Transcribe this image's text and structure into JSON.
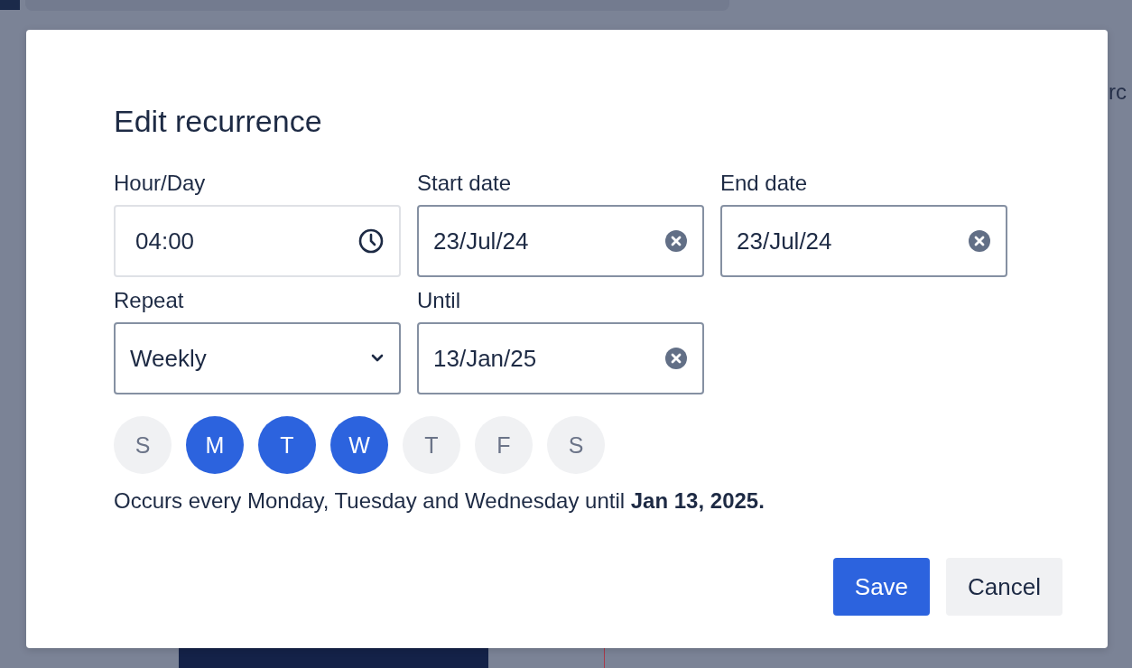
{
  "background": {
    "search_fragment": "rc"
  },
  "dialog": {
    "title": "Edit recurrence",
    "fields": [
      {
        "label": "Hour/Day",
        "kind": "time",
        "value": "04:00"
      },
      {
        "label": "Start date",
        "kind": "date",
        "value": "23/Jul/24"
      },
      {
        "label": "End date",
        "kind": "date",
        "value": "23/Jul/24"
      },
      {
        "label": "Repeat",
        "kind": "select",
        "value": "Weekly"
      },
      {
        "label": "Until",
        "kind": "date",
        "value": "13/Jan/25"
      }
    ],
    "days": [
      {
        "label": "S",
        "selected": false
      },
      {
        "label": "M",
        "selected": true
      },
      {
        "label": "T",
        "selected": true
      },
      {
        "label": "W",
        "selected": true
      },
      {
        "label": "T",
        "selected": false
      },
      {
        "label": "F",
        "selected": false
      },
      {
        "label": "S",
        "selected": false
      }
    ],
    "summary": "Occurs every Monday, Tuesday and Wednesday until **Jan 13, 2025.**",
    "buttons": [
      {
        "label": "Save",
        "kind": "primary"
      },
      {
        "label": "Cancel",
        "kind": "secondary"
      }
    ]
  }
}
